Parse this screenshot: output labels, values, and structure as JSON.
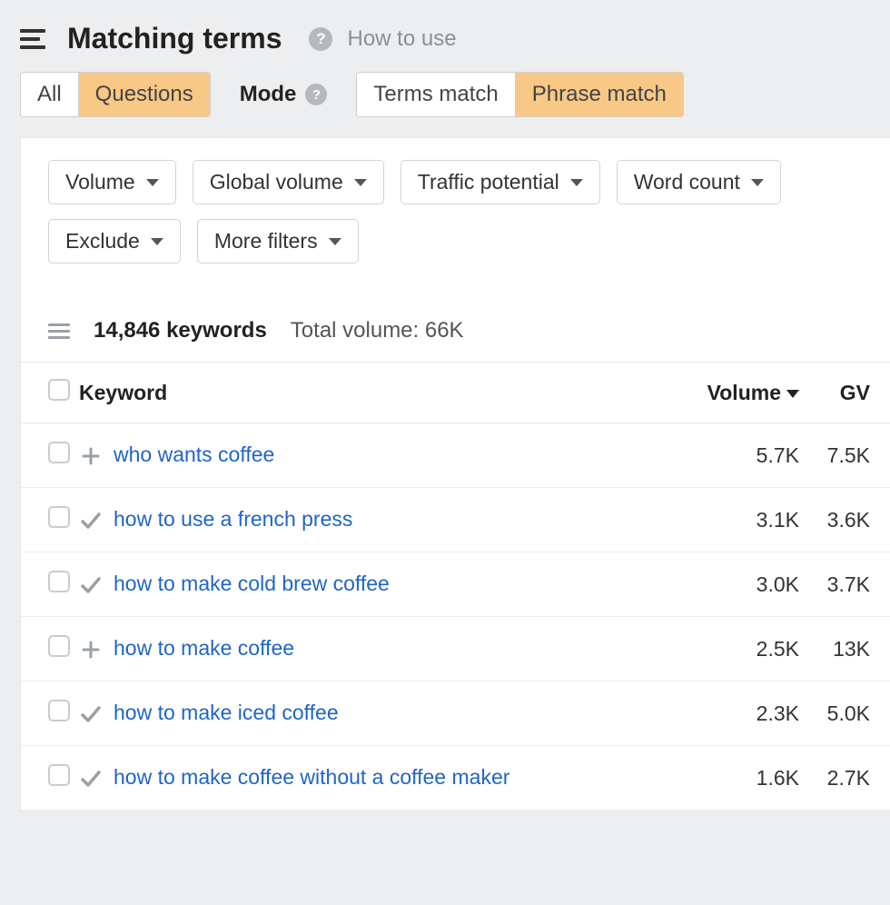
{
  "header": {
    "title": "Matching terms",
    "how_to_use": "How to use"
  },
  "segments": {
    "all": "All",
    "questions": "Questions"
  },
  "mode": {
    "label": "Mode",
    "terms": "Terms match",
    "phrase": "Phrase match"
  },
  "filters": {
    "volume": "Volume",
    "global_volume": "Global volume",
    "traffic_potential": "Traffic potential",
    "word_count": "Word count",
    "exclude": "Exclude",
    "more_filters": "More filters"
  },
  "results": {
    "count_label": "14,846 keywords",
    "total_volume_label": "Total volume: 66K"
  },
  "columns": {
    "keyword": "Keyword",
    "volume": "Volume",
    "gv": "GV"
  },
  "rows": [
    {
      "icon": "plus",
      "keyword": "who wants coffee",
      "volume": "5.7K",
      "gv": "7.5K"
    },
    {
      "icon": "check",
      "keyword": "how to use a french press",
      "volume": "3.1K",
      "gv": "3.6K"
    },
    {
      "icon": "check",
      "keyword": "how to make cold brew coffee",
      "volume": "3.0K",
      "gv": "3.7K"
    },
    {
      "icon": "plus",
      "keyword": "how to make coffee",
      "volume": "2.5K",
      "gv": "13K"
    },
    {
      "icon": "check",
      "keyword": "how to make iced coffee",
      "volume": "2.3K",
      "gv": "5.0K"
    },
    {
      "icon": "check",
      "keyword": "how to make coffee without a coffee maker",
      "volume": "1.6K",
      "gv": "2.7K"
    }
  ]
}
